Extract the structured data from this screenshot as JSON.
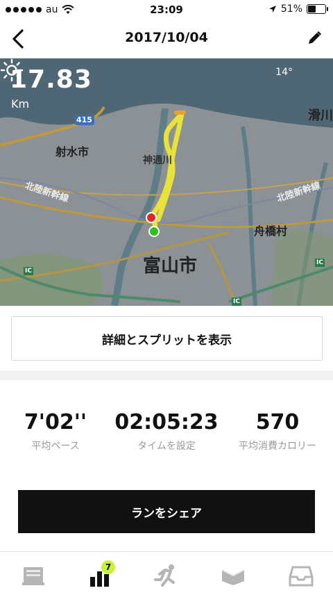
{
  "status_bar": {
    "carrier": "au",
    "time": "23:09",
    "battery": "51%",
    "battery_fraction": 0.51
  },
  "header": {
    "title": "2017/10/04"
  },
  "map": {
    "distance": "17.83",
    "distance_unit": "Km",
    "temperature": "14°",
    "weather_icon": "sun-icon",
    "labels": {
      "road": "415",
      "city_left": "射水市",
      "city_main": "富山市",
      "city_right": "舟橋村",
      "city_topright": "滑川",
      "rail_left": "北陸新幹線",
      "rail_right": "北陸新幹線",
      "town": "神通川",
      "ic": "IC"
    }
  },
  "details_button": "詳細とスプリットを表示",
  "stats": [
    {
      "value": "7'02''",
      "label": "平均ペース"
    },
    {
      "value": "02:05:23",
      "label": "タイムを設定"
    },
    {
      "value": "570",
      "label": "平均消費カロリー"
    }
  ],
  "share_button": "ランをシェア",
  "tabbar": {
    "badge_count": "7",
    "tabs": [
      "feed-icon",
      "activity-icon",
      "run-icon",
      "coach-icon",
      "inbox-icon"
    ]
  },
  "colors": {
    "accent": "#c6f23a",
    "route": "#e8e23a",
    "start": "#2ec01e",
    "end": "#e42525"
  }
}
